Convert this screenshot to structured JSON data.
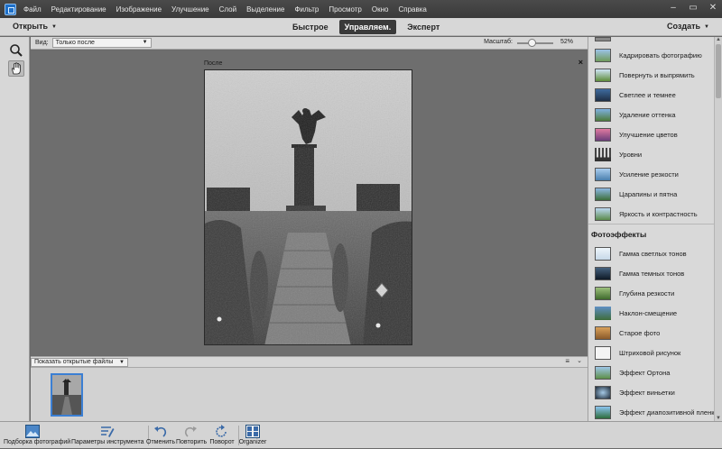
{
  "menu": {
    "items": [
      "Файл",
      "Редактирование",
      "Изображение",
      "Улучшение",
      "Слой",
      "Выделение",
      "Фильтр",
      "Просмотр",
      "Окно",
      "Справка"
    ]
  },
  "modebar": {
    "open_label": "Открыть",
    "modes": [
      "Быстрое",
      "Управляем.",
      "Эксперт"
    ],
    "active_mode": "Управляем.",
    "create_label": "Создать"
  },
  "viewbar": {
    "view_label": "Вид:",
    "view_value": "Только после",
    "zoom_label": "Масштаб:",
    "zoom_value": "52%",
    "zoom_fraction": 0.52
  },
  "canvas": {
    "after_label": "После",
    "close_glyph": "×"
  },
  "bin": {
    "select_value": "Показать открытые файлы",
    "menu_glyph": "≡",
    "collapse_glyph": "⌄"
  },
  "right_panel": {
    "items_top": [
      {
        "label": "Кадрировать фотографию",
        "icon": "crop-photo-icon"
      },
      {
        "label": "Повернуть и выпрямить",
        "icon": "rotate-straighten-icon"
      },
      {
        "label": "Светлее и темнее",
        "icon": "lighten-darken-icon"
      },
      {
        "label": "Удаление оттенка",
        "icon": "remove-color-cast-icon"
      },
      {
        "label": "Улучшение цветов",
        "icon": "enhance-colors-icon"
      },
      {
        "label": "Уровни",
        "icon": "levels-histogram-icon"
      },
      {
        "label": "Усиление резкости",
        "icon": "sharpen-icon"
      },
      {
        "label": "Царапины и пятна",
        "icon": "scratches-blemishes-icon"
      },
      {
        "label": "Яркость и контрастность",
        "icon": "brightness-contrast-icon"
      }
    ],
    "section_title": "Фотоэффекты",
    "items_effects": [
      {
        "label": "Гамма светлых тонов",
        "icon": "high-key-icon"
      },
      {
        "label": "Гамма темных тонов",
        "icon": "low-key-icon"
      },
      {
        "label": "Глубина резкости",
        "icon": "depth-of-field-icon"
      },
      {
        "label": "Наклон-смещение",
        "icon": "tilt-shift-icon"
      },
      {
        "label": "Старое фото",
        "icon": "old-photo-icon"
      },
      {
        "label": "Штриховой рисунок",
        "icon": "line-drawing-icon"
      },
      {
        "label": "Эффект Ортона",
        "icon": "orton-effect-icon"
      },
      {
        "label": "Эффект виньетки",
        "icon": "vignette-effect-icon"
      },
      {
        "label": "Эффект диапозитивной пленки",
        "icon": "reversal-film-icon"
      }
    ]
  },
  "taskbar": {
    "buttons": [
      {
        "label": "Подборка фотографий",
        "icon": "photo-bin-icon"
      },
      {
        "label": "Параметры инструмента",
        "icon": "tool-options-icon"
      },
      {
        "label": "Отменить",
        "icon": "undo-icon"
      },
      {
        "label": "Повторить",
        "icon": "redo-icon"
      },
      {
        "label": "Поворот",
        "icon": "rotate-icon"
      },
      {
        "label": "Organizer",
        "icon": "organizer-icon"
      }
    ]
  },
  "colors": {
    "menu_bg": "#3c3c3c",
    "panel_bg": "#d7d7d7",
    "canvas_bg": "#6e6e6e",
    "selection_blue": "#3b7fd3"
  }
}
